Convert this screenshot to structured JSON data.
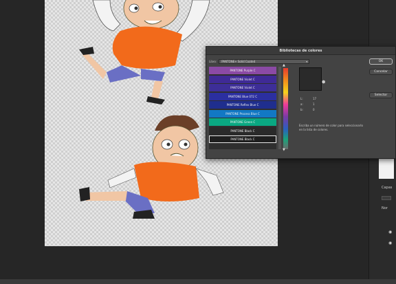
{
  "dialog": {
    "title": "Bibliotecas de colores",
    "book_label": "Libro:",
    "book_value": "PANTONE+ Solid Coated",
    "swatches": [
      {
        "name": "PANTONE Purple C",
        "color": "#8b4aa5"
      },
      {
        "name": "PANTONE Violet C",
        "color": "#3f2a96"
      },
      {
        "name": "PANTONE Violet C",
        "color": "#3d2e98"
      },
      {
        "name": "PANTONE Blue 072 C",
        "color": "#2b2fa0"
      },
      {
        "name": "PANTONE Reflex Blue C",
        "color": "#1f2e8e"
      },
      {
        "name": "PANTONE Process Blue C",
        "color": "#1278c4"
      },
      {
        "name": "PANTONE Green C",
        "color": "#0aa882"
      },
      {
        "name": "PANTONE Black C",
        "color": "#2a2a2a"
      },
      {
        "name": "PANTONE Black C",
        "color": "#1f1f1f"
      }
    ],
    "lab": [
      {
        "key": "L:",
        "value": "17"
      },
      {
        "key": "a:",
        "value": "1"
      },
      {
        "key": "b:",
        "value": "0"
      }
    ],
    "hint": "Escriba un número de color para seleccionarlo en la lista de colores.",
    "buttons": {
      "ok": "OK",
      "cancel": "Cancelar",
      "picker": "Selector"
    },
    "preview_color": "#2a2a2a"
  },
  "right_panel": {
    "labels": [
      "Capas",
      "CL Tu",
      "Nor"
    ],
    "icons": [
      "eye-icon",
      "eye-icon"
    ]
  }
}
